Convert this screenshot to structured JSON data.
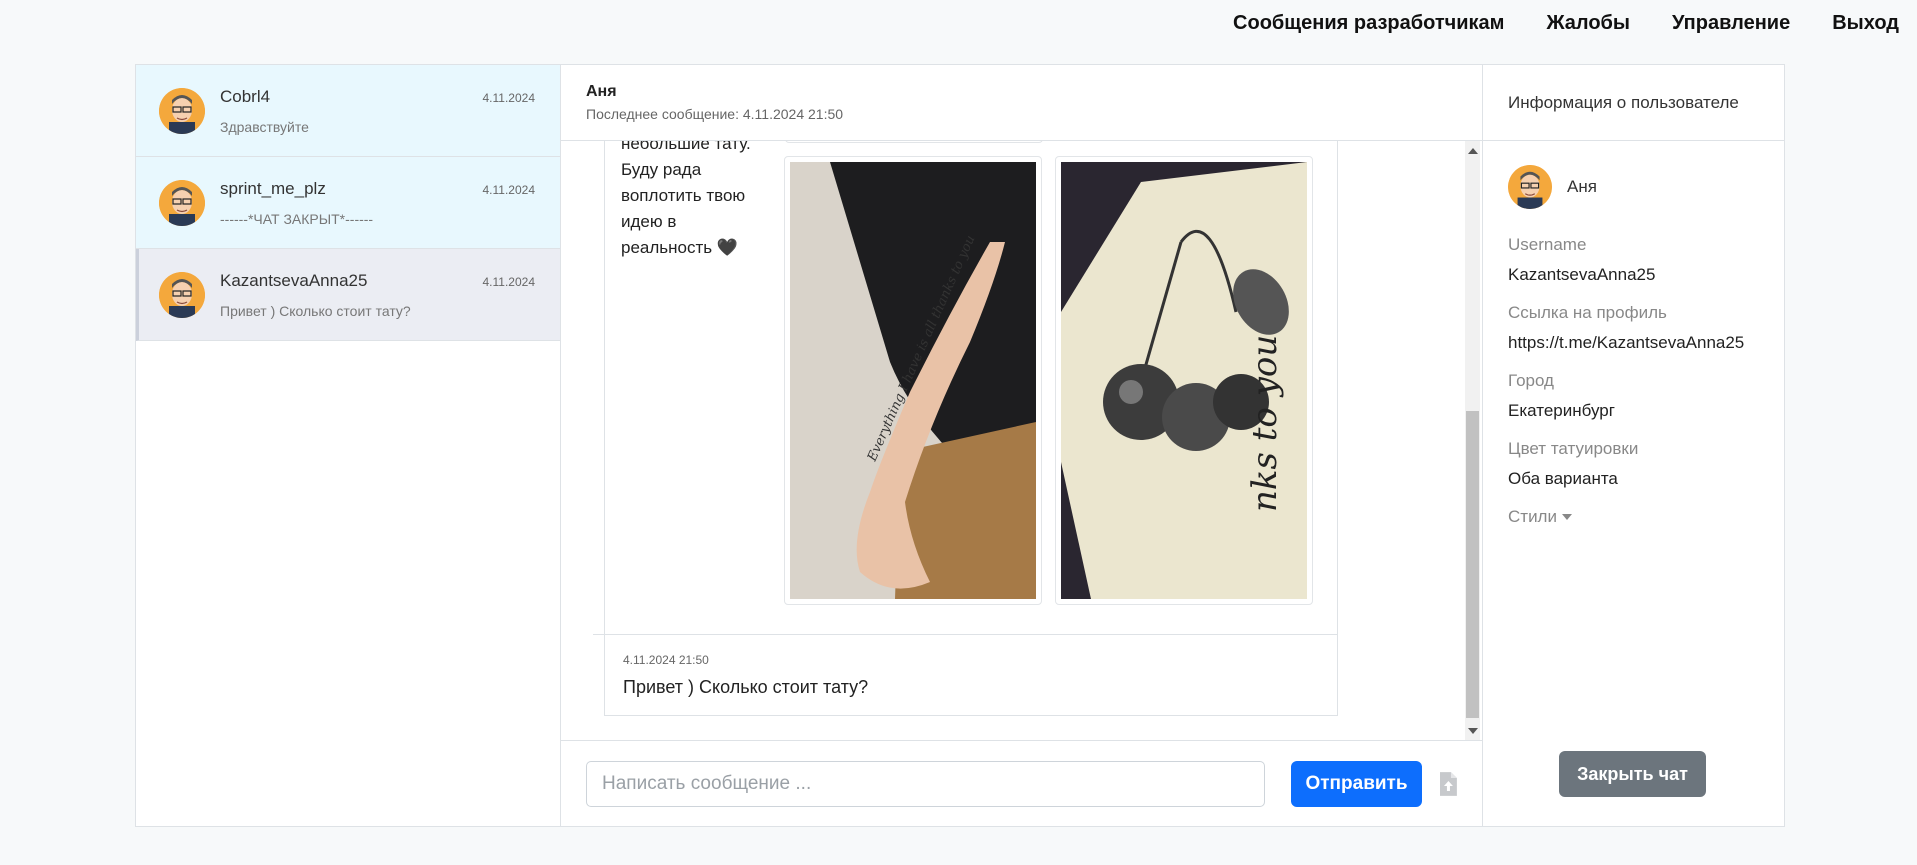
{
  "nav": {
    "items": [
      "Сообщения разработчикам",
      "Жалобы",
      "Управление",
      "Выход"
    ]
  },
  "chats": [
    {
      "name": "Cobrl4",
      "date": "4.11.2024",
      "last": "Здравствуйте"
    },
    {
      "name": "sprint_me_plz",
      "date": "4.11.2024",
      "last": "------*ЧАТ ЗАКРЫТ*------"
    },
    {
      "name": "KazantsevaAnna25",
      "date": "4.11.2024",
      "last": "Привет ) Сколько стоит тату?"
    }
  ],
  "conversation": {
    "title": "Аня",
    "subtitle": "Последнее сообщение: 4.11.2024 21:50",
    "message1_lines": [
      "небольшие тату.",
      "Буду рада",
      "воплотить твою",
      "идею в",
      "реальность 🖤"
    ],
    "message2": {
      "time": "4.11.2024 21:50",
      "text": "Привет ) Сколько стоит тату?"
    }
  },
  "composer": {
    "placeholder": "Написать сообщение ...",
    "send_label": "Отправить"
  },
  "info": {
    "header": "Информация о пользователе",
    "name": "Аня",
    "fields": [
      {
        "label": "Username",
        "value": "KazantsevaAnna25"
      },
      {
        "label": "Ссылка на профиль",
        "value": "https://t.me/KazantsevaAnna25"
      },
      {
        "label": "Город",
        "value": "Екатеринбург"
      },
      {
        "label": "Цвет татуировки",
        "value": "Оба варианта"
      }
    ],
    "styles_label": "Стили",
    "close_label": "Закрыть чат"
  }
}
